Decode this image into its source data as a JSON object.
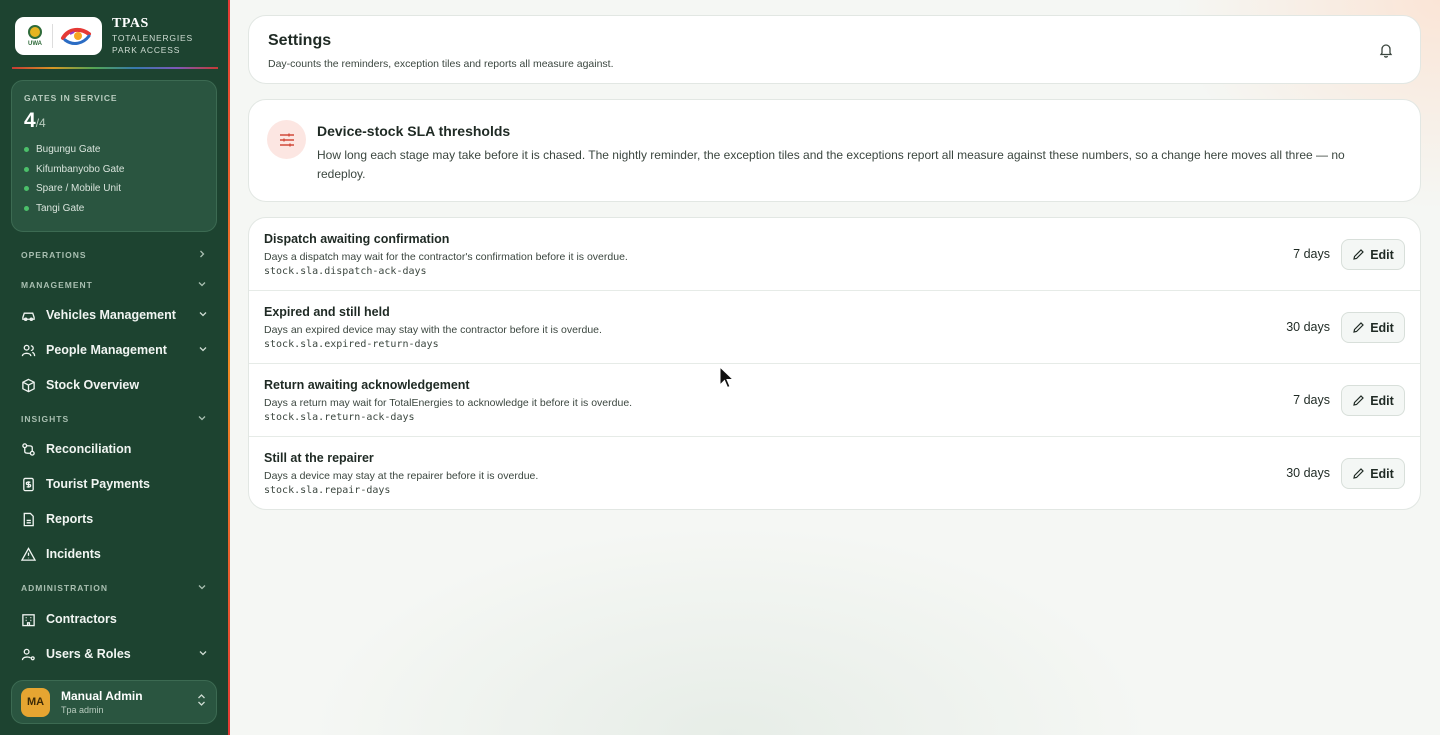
{
  "sidebar": {
    "brand": {
      "logo_uwa_text": "UWA",
      "title": "TPAS",
      "subtitle_line1": "TOTALENERGIES",
      "subtitle_line2": "PARK ACCESS"
    },
    "gates": {
      "label": "GATES IN SERVICE",
      "count": "4",
      "total": "/4",
      "items": [
        "Bugungu Gate",
        "Kifumbanyobo Gate",
        "Spare / Mobile Unit",
        "Tangi Gate"
      ]
    },
    "sections": {
      "operations": "OPERATIONS",
      "management": "MANAGEMENT",
      "insights": "INSIGHTS",
      "administration": "ADMINISTRATION"
    },
    "nav": {
      "vehicles": "Vehicles Management",
      "people": "People Management",
      "stock": "Stock Overview",
      "reconciliation": "Reconciliation",
      "tourist_payments": "Tourist Payments",
      "reports": "Reports",
      "incidents": "Incidents",
      "contractors": "Contractors",
      "users_roles": "Users & Roles"
    },
    "user": {
      "initials": "MA",
      "name": "Manual Admin",
      "role": "Tpa admin"
    }
  },
  "header": {
    "title": "Settings",
    "subtitle": "Day-counts the reminders, exception tiles and reports all measure against."
  },
  "info": {
    "title": "Device-stock SLA thresholds",
    "description": "How long each stage may take before it is chased. The nightly reminder, the exception tiles and the exceptions report all measure against these numbers, so a change here moves all three — no redeploy."
  },
  "settings": [
    {
      "title": "Dispatch awaiting confirmation",
      "description": "Days a dispatch may wait for the contractor's confirmation before it is overdue.",
      "key": "stock.sla.dispatch-ack-days",
      "value": "7 days",
      "action": "Edit"
    },
    {
      "title": "Expired and still held",
      "description": "Days an expired device may stay with the contractor before it is overdue.",
      "key": "stock.sla.expired-return-days",
      "value": "30 days",
      "action": "Edit"
    },
    {
      "title": "Return awaiting acknowledgement",
      "description": "Days a return may wait for TotalEnergies to acknowledge it before it is overdue.",
      "key": "stock.sla.return-ack-days",
      "value": "7 days",
      "action": "Edit"
    },
    {
      "title": "Still at the repairer",
      "description": "Days a device may stay at the repairer before it is overdue.",
      "key": "stock.sla.repair-days",
      "value": "30 days",
      "action": "Edit"
    }
  ],
  "colors": {
    "sidebar": "#1d4330",
    "accent_red": "#e53935",
    "gate_dot": "#4cc06a",
    "avatar": "#e6a531"
  }
}
